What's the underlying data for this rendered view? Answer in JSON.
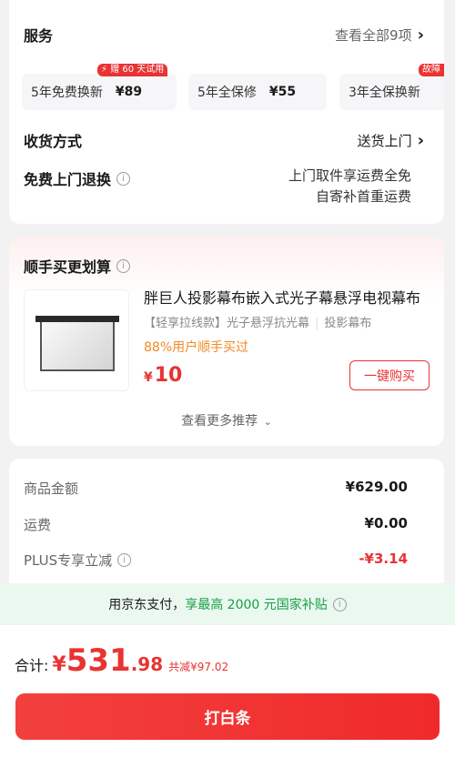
{
  "services": {
    "title": "服务",
    "view_all": "查看全部9项",
    "chips": [
      {
        "label": "5年免费换新",
        "price": "¥89",
        "badge": "⚡ 赠 60 天试用"
      },
      {
        "label": "5年全保修",
        "price": "¥55",
        "badge": ""
      },
      {
        "label": "3年全保换新",
        "price": "",
        "badge": "故障"
      }
    ]
  },
  "delivery": {
    "label": "收货方式",
    "value": "送货上门"
  },
  "returns": {
    "label": "免费上门退换",
    "line1": "上门取件享运费全免",
    "line2": "自寄补首重运费"
  },
  "combo": {
    "title": "顺手买更划算",
    "product": {
      "title": "胖巨人投影幕布嵌入式光子幕悬浮电视幕布",
      "tag1": "【轻享拉线款】光子悬浮抗光幕",
      "tag2": "投影幕布",
      "bought": "88%用户顺手买过",
      "price_symbol": "¥",
      "price": "10",
      "buy_label": "一键购买"
    },
    "more_label": "查看更多推荐"
  },
  "summary": {
    "rows": [
      {
        "label": "商品金额",
        "value": "¥629.00"
      },
      {
        "label": "运费",
        "value": "¥0.00"
      },
      {
        "label": "PLUS专享立减",
        "value": "-¥3.14"
      }
    ]
  },
  "subsidy": {
    "prefix": "用京东支付，",
    "highlight": "享最高 2000 元国家补贴"
  },
  "footer": {
    "total_label": "合计:",
    "yen": "¥",
    "total_int": "531",
    "total_dec": ".98",
    "saving": "共减¥97.02",
    "pay_label": "打白条"
  },
  "colors": {
    "accent": "#e93333",
    "green": "#1a9e48",
    "orange": "#f08a24"
  }
}
